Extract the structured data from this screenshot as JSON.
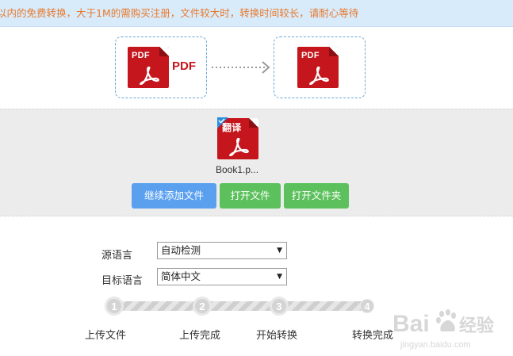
{
  "notice": {
    "text": "以内的免费转换，大于1M的需购买注册，文件较大时，转换时间较长，请耐心等待"
  },
  "conversion": {
    "source_icon_label": "PDF",
    "source_format_text": "PDF",
    "target_icon_label": "PDF"
  },
  "file": {
    "badge_text": "翻译",
    "name": "Book1.p..."
  },
  "buttons": {
    "add_files": "继续添加文件",
    "open_file": "打开文件",
    "open_folder": "打开文件夹"
  },
  "language": {
    "source_label": "源语言",
    "source_value": "自动检测",
    "target_label": "目标语言",
    "target_value": "简体中文"
  },
  "steps": [
    {
      "number": "1",
      "label": "上传文件"
    },
    {
      "number": "2",
      "label": "上传完成"
    },
    {
      "number": "3",
      "label": "开始转换"
    },
    {
      "number": "4",
      "label": "转换完成"
    }
  ],
  "watermark": {
    "brand": "Bai",
    "brand_suffix": "经验",
    "url": "jingyan.baidu.com"
  },
  "colors": {
    "notice_bg": "#d8ebfb",
    "notice_text": "#e8792c",
    "pdf_red": "#c4161c",
    "button_blue": "#5aa0ef",
    "button_green": "#5cc15c"
  }
}
